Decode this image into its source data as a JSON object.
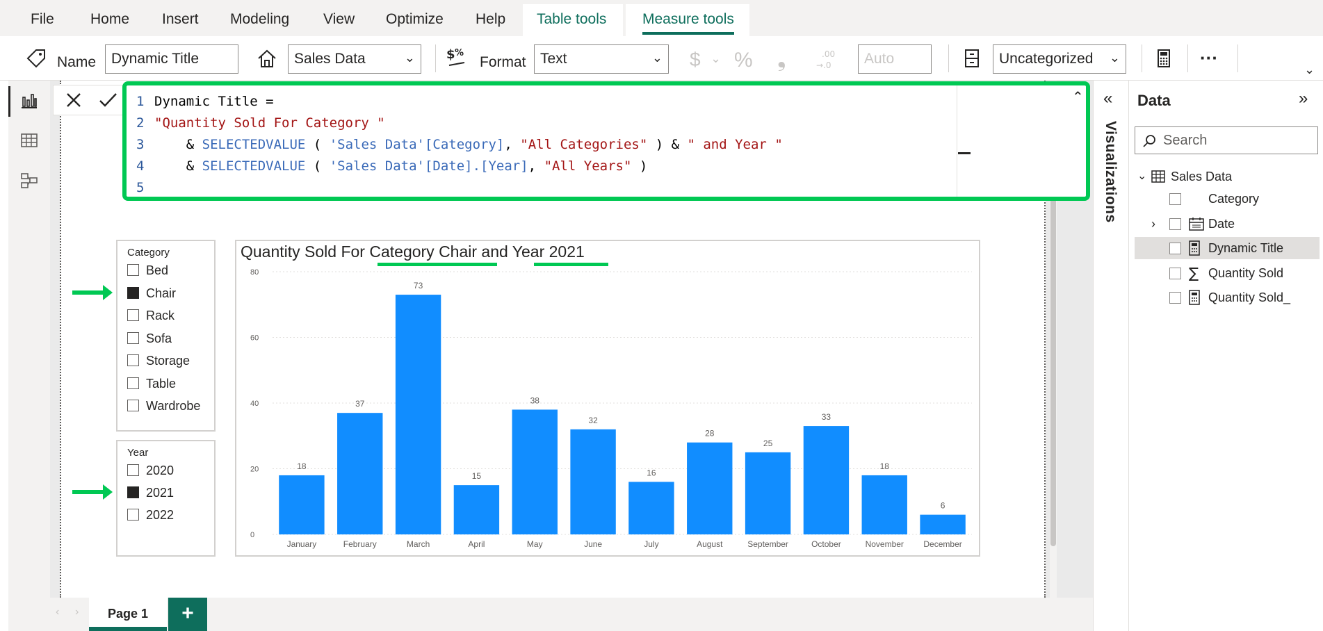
{
  "ribbon": {
    "tabs": [
      "File",
      "Home",
      "Insert",
      "Modeling",
      "View",
      "Optimize",
      "Help",
      "Table tools",
      "Measure tools"
    ]
  },
  "toolbar": {
    "name_label": "Name",
    "name_value": "Dynamic Title",
    "home_table": "Sales Data",
    "format_label": "Format",
    "format_value": "Text",
    "currency_symbol": "$",
    "percent_symbol": "%",
    "comma_symbol": "❟",
    "decimal_places": "Auto",
    "data_category": "Uncategorized",
    "more": "···"
  },
  "formula": {
    "lines": [
      {
        "num": "1",
        "parts": [
          {
            "t": "Dynamic Title =",
            "c": "plain"
          }
        ]
      },
      {
        "num": "2",
        "parts": [
          {
            "t": "\"Quantity Sold For Category \"",
            "c": "str"
          }
        ]
      },
      {
        "num": "3",
        "parts": [
          {
            "t": "    & ",
            "c": "plain"
          },
          {
            "t": "SELECTEDVALUE",
            "c": "kw-fn"
          },
          {
            "t": " ( ",
            "c": "plain"
          },
          {
            "t": "'Sales Data'[Category]",
            "c": "kw-fn"
          },
          {
            "t": ", ",
            "c": "plain"
          },
          {
            "t": "\"All Categories\"",
            "c": "str"
          },
          {
            "t": " ) & ",
            "c": "plain"
          },
          {
            "t": "\" and Year \"",
            "c": "str"
          }
        ]
      },
      {
        "num": "4",
        "parts": [
          {
            "t": "    & ",
            "c": "plain"
          },
          {
            "t": "SELECTEDVALUE",
            "c": "kw-fn"
          },
          {
            "t": " ( ",
            "c": "plain"
          },
          {
            "t": "'Sales Data'[Date].[Year]",
            "c": "kw-fn"
          },
          {
            "t": ", ",
            "c": "plain"
          },
          {
            "t": "\"All Years\"",
            "c": "str"
          },
          {
            "t": " )",
            "c": "plain"
          }
        ]
      },
      {
        "num": "5",
        "parts": []
      }
    ]
  },
  "category_slicer": {
    "title": "Category",
    "items": [
      {
        "label": "Bed",
        "checked": false
      },
      {
        "label": "Chair",
        "checked": true
      },
      {
        "label": "Rack",
        "checked": false
      },
      {
        "label": "Sofa",
        "checked": false
      },
      {
        "label": "Storage",
        "checked": false
      },
      {
        "label": "Table",
        "checked": false
      },
      {
        "label": "Wardrobe",
        "checked": false
      }
    ]
  },
  "year_slicer": {
    "title": "Year",
    "items": [
      {
        "label": "2020",
        "checked": false
      },
      {
        "label": "2021",
        "checked": true
      },
      {
        "label": "2022",
        "checked": false
      }
    ]
  },
  "chart_data": {
    "type": "bar",
    "title": "Quantity Sold For Category Chair and Year 2021",
    "categories": [
      "January",
      "February",
      "March",
      "April",
      "May",
      "June",
      "July",
      "August",
      "September",
      "October",
      "November",
      "December"
    ],
    "values": [
      18,
      37,
      73,
      15,
      38,
      32,
      16,
      28,
      25,
      33,
      18,
      6
    ],
    "yticks": [
      0,
      20,
      40,
      60,
      80
    ],
    "ylim": [
      0,
      80
    ],
    "bar_color": "#118DFF",
    "grid": true
  },
  "visualizations": {
    "label": "Visualizations"
  },
  "data_pane": {
    "title": "Data",
    "search_placeholder": "Search",
    "table": "Sales Data",
    "fields": [
      {
        "label": "Category",
        "icon": "none"
      },
      {
        "label": "Date",
        "icon": "calendar-icon"
      },
      {
        "label": "Dynamic Title",
        "icon": "calculator-icon"
      },
      {
        "label": "Quantity Sold",
        "icon": "sigma-icon"
      },
      {
        "label": "Quantity Sold_",
        "icon": "calculator-icon"
      }
    ]
  },
  "pages": {
    "tab": "Page 1",
    "add": "+"
  },
  "colors": {
    "accent": "#0e6e5c",
    "highlight": "#00c853",
    "bar": "#118DFF"
  }
}
